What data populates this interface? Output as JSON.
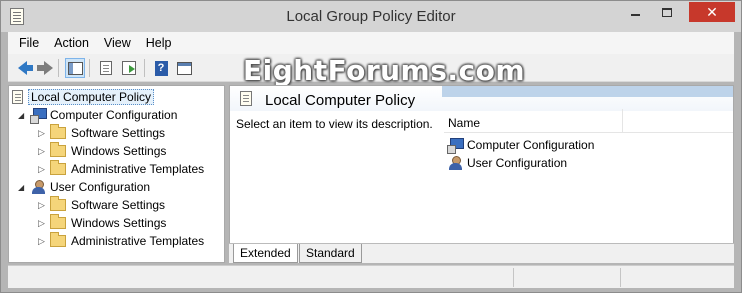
{
  "window": {
    "title": "Local Group Policy Editor",
    "controls": {
      "minimize": "",
      "maximize": "",
      "close": "✕"
    }
  },
  "menu": [
    "File",
    "Action",
    "View",
    "Help"
  ],
  "toolbar": {
    "buttons": [
      "back-icon",
      "forward-icon",
      "show-hide-tree-icon",
      "properties-doc-icon",
      "export-list-icon",
      "help-icon",
      "show-hide-action-pane-icon"
    ]
  },
  "watermark": "EightForums.com",
  "tree": {
    "root": "Local Computer Policy",
    "nodes": [
      {
        "label": "Computer Configuration",
        "children": [
          "Software Settings",
          "Windows Settings",
          "Administrative Templates"
        ]
      },
      {
        "label": "User Configuration",
        "children": [
          "Software Settings",
          "Windows Settings",
          "Administrative Templates"
        ]
      }
    ]
  },
  "details": {
    "header_title": "Local Computer Policy",
    "description": "Select an item to view its description.",
    "column_name": "Name",
    "items": [
      "Computer Configuration",
      "User Configuration"
    ]
  },
  "tabs": [
    "Extended",
    "Standard"
  ],
  "colors": {
    "close_button": "#c7382b",
    "header_band": "#bdd3ea",
    "selection": "#e5f1fb"
  }
}
